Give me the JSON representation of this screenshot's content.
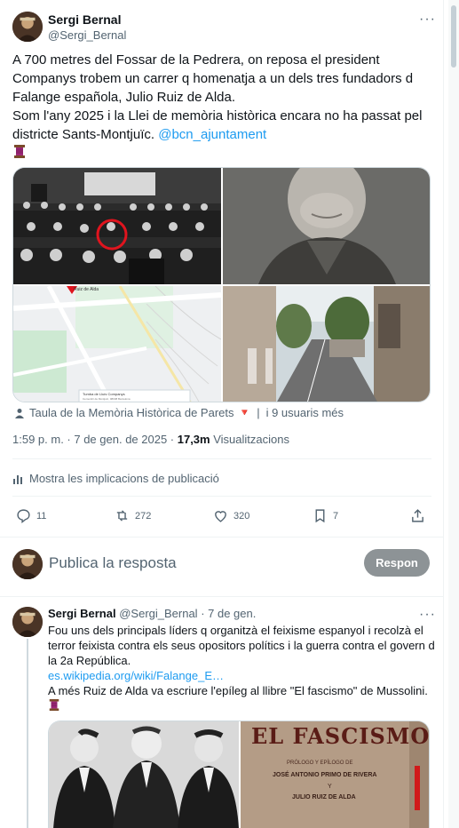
{
  "tweet": {
    "author_name": "Sergi Bernal",
    "author_handle": "@Sergi_Bernal",
    "more_label": "···",
    "text_part1": "A 700 metres del Fossar de la Pedrera, on reposa el president Companys trobem un carrer q homenatja a un dels tres fundadors d Falange española, Julio Ruiz de Alda.\nSom l'any 2025 i la Llei de memòria històrica encara no ha passat pel districte Sants-Montjuïc. ",
    "mention": "@bcn_ajuntament",
    "emoji_icon": "spool-of-thread-emoji",
    "tagged": "Taula de la Memòria Històrica de Parets",
    "tagged_flag": "🔻",
    "tagged_more": "i 9 usuaris més",
    "time": "1:59 p. m. · 7 de gen. de 2025 · ",
    "views_count": "17,3m",
    "views_label": " Visualitzacions",
    "analytics_label": "Mostra les implicacions de publicació",
    "replies": "11",
    "reposts": "272",
    "likes": "320",
    "bookmarks": "7",
    "map_card_title": "Tumba de Lluís Companys",
    "map_card_subtitle": "Cementiri de Montjuïc, 08038 Barcelona",
    "map_pin_label": "Ruiz de Alda"
  },
  "compose": {
    "placeholder": "Publica la resposta",
    "reply_button": "Respon"
  },
  "reply": {
    "author_name": "Sergi Bernal",
    "author_handle": "@Sergi_Bernal",
    "date": " · 7 de gen.",
    "more_label": "···",
    "text1": "Fou uns dels principals líders q organitzà el feixisme espanyol i recolzà el terror feixista contra els seus opositors polítics i la guerra contra el govern d la 2a República.",
    "link": "es.wikipedia.org/wiki/Falange_E…",
    "text2": "A més Ruiz de Alda va escriure l'epíleg al llibre \"El fascismo\" de Mussolini.",
    "book_title": "EL FASCISMO",
    "book_line1": "PRÓLOGO Y EPÍLOGO DE",
    "book_line2": "JOSÉ ANTONIO PRIMO DE RIVERA",
    "book_line3": "Y",
    "book_line4": "JULIO RUIZ DE ALDA"
  },
  "colors": {
    "accent": "#1d9bf0",
    "muted": "#536471",
    "reply_button": "#8d9396",
    "tagged_flag": "#f4212e"
  }
}
